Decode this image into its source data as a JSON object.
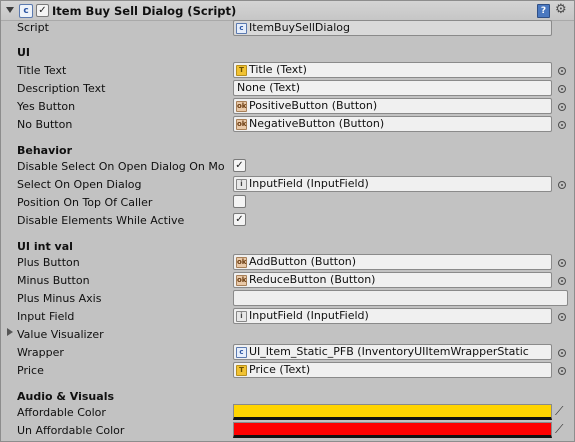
{
  "component": {
    "title": "Item Buy Sell Dialog (Script)",
    "enabled": true
  },
  "script_row": {
    "label": "Script",
    "value": "ItemBuySellDialog"
  },
  "sections": {
    "ui": "UI",
    "behavior": "Behavior",
    "ui_int_val": "UI int val",
    "audio_visuals": "Audio & Visuals"
  },
  "ui_fields": {
    "title_text": {
      "label": "Title Text",
      "value": "Title (Text)"
    },
    "description_text": {
      "label": "Description Text",
      "value": "None (Text)"
    },
    "yes_button": {
      "label": "Yes Button",
      "value": "PositiveButton (Button)"
    },
    "no_button": {
      "label": "No Button",
      "value": "NegativeButton (Button)"
    }
  },
  "behavior_fields": {
    "disable_select": {
      "label": "Disable Select On Open Dialog On Mo",
      "checked": true
    },
    "select_on_open": {
      "label": "Select On Open Dialog",
      "value": "InputField (InputField)"
    },
    "position_on_top": {
      "label": "Position On Top Of Caller",
      "checked": false
    },
    "disable_elements": {
      "label": "Disable Elements While Active",
      "checked": true
    }
  },
  "ui_int_val_fields": {
    "plus_button": {
      "label": "Plus Button",
      "value": "AddButton (Button)"
    },
    "minus_button": {
      "label": "Minus Button",
      "value": "ReduceButton (Button)"
    },
    "plus_minus_axis": {
      "label": "Plus Minus Axis",
      "value": ""
    },
    "input_field": {
      "label": "Input Field",
      "value": "InputField (InputField)"
    },
    "value_visualizer": {
      "label": "Value Visualizer"
    },
    "wrapper": {
      "label": "Wrapper",
      "value": "UI_Item_Static_PFB (InventoryUIItemWrapperStatic"
    },
    "price": {
      "label": "Price",
      "value": "Price (Text)"
    }
  },
  "audio_visuals_fields": {
    "affordable_color": {
      "label": "Affordable Color",
      "color": "#ffd400"
    },
    "unaffordable_color": {
      "label": "Un Affordable Color",
      "color": "#ff0000"
    }
  },
  "glyphs": {
    "check": "✓",
    "script_icon": "c",
    "text_icon": "T",
    "button_icon": "ok",
    "input_icon": "i",
    "help": "?",
    "settings": "⚙",
    "eyedropper": "⟋"
  }
}
